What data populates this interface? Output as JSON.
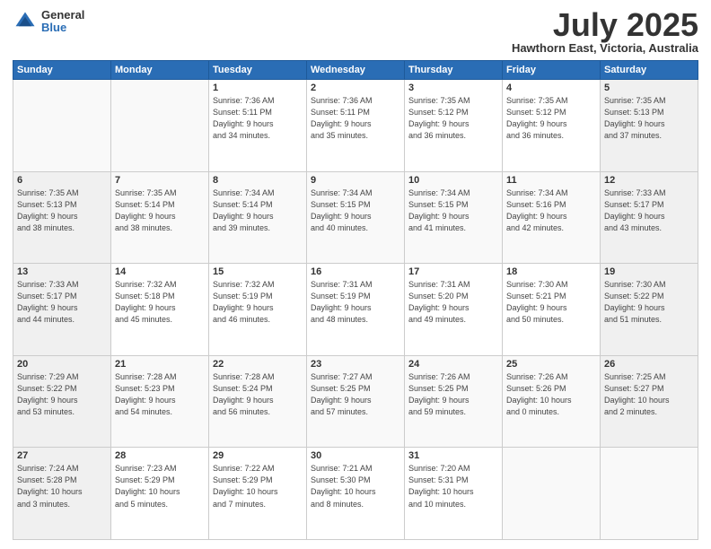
{
  "header": {
    "logo_general": "General",
    "logo_blue": "Blue",
    "month": "July 2025",
    "location": "Hawthorn East, Victoria, Australia"
  },
  "days_of_week": [
    "Sunday",
    "Monday",
    "Tuesday",
    "Wednesday",
    "Thursday",
    "Friday",
    "Saturday"
  ],
  "weeks": [
    [
      {
        "day": "",
        "info": ""
      },
      {
        "day": "",
        "info": ""
      },
      {
        "day": "1",
        "info": "Sunrise: 7:36 AM\nSunset: 5:11 PM\nDaylight: 9 hours\nand 34 minutes."
      },
      {
        "day": "2",
        "info": "Sunrise: 7:36 AM\nSunset: 5:11 PM\nDaylight: 9 hours\nand 35 minutes."
      },
      {
        "day": "3",
        "info": "Sunrise: 7:35 AM\nSunset: 5:12 PM\nDaylight: 9 hours\nand 36 minutes."
      },
      {
        "day": "4",
        "info": "Sunrise: 7:35 AM\nSunset: 5:12 PM\nDaylight: 9 hours\nand 36 minutes."
      },
      {
        "day": "5",
        "info": "Sunrise: 7:35 AM\nSunset: 5:13 PM\nDaylight: 9 hours\nand 37 minutes."
      }
    ],
    [
      {
        "day": "6",
        "info": "Sunrise: 7:35 AM\nSunset: 5:13 PM\nDaylight: 9 hours\nand 38 minutes."
      },
      {
        "day": "7",
        "info": "Sunrise: 7:35 AM\nSunset: 5:14 PM\nDaylight: 9 hours\nand 38 minutes."
      },
      {
        "day": "8",
        "info": "Sunrise: 7:34 AM\nSunset: 5:14 PM\nDaylight: 9 hours\nand 39 minutes."
      },
      {
        "day": "9",
        "info": "Sunrise: 7:34 AM\nSunset: 5:15 PM\nDaylight: 9 hours\nand 40 minutes."
      },
      {
        "day": "10",
        "info": "Sunrise: 7:34 AM\nSunset: 5:15 PM\nDaylight: 9 hours\nand 41 minutes."
      },
      {
        "day": "11",
        "info": "Sunrise: 7:34 AM\nSunset: 5:16 PM\nDaylight: 9 hours\nand 42 minutes."
      },
      {
        "day": "12",
        "info": "Sunrise: 7:33 AM\nSunset: 5:17 PM\nDaylight: 9 hours\nand 43 minutes."
      }
    ],
    [
      {
        "day": "13",
        "info": "Sunrise: 7:33 AM\nSunset: 5:17 PM\nDaylight: 9 hours\nand 44 minutes."
      },
      {
        "day": "14",
        "info": "Sunrise: 7:32 AM\nSunset: 5:18 PM\nDaylight: 9 hours\nand 45 minutes."
      },
      {
        "day": "15",
        "info": "Sunrise: 7:32 AM\nSunset: 5:19 PM\nDaylight: 9 hours\nand 46 minutes."
      },
      {
        "day": "16",
        "info": "Sunrise: 7:31 AM\nSunset: 5:19 PM\nDaylight: 9 hours\nand 48 minutes."
      },
      {
        "day": "17",
        "info": "Sunrise: 7:31 AM\nSunset: 5:20 PM\nDaylight: 9 hours\nand 49 minutes."
      },
      {
        "day": "18",
        "info": "Sunrise: 7:30 AM\nSunset: 5:21 PM\nDaylight: 9 hours\nand 50 minutes."
      },
      {
        "day": "19",
        "info": "Sunrise: 7:30 AM\nSunset: 5:22 PM\nDaylight: 9 hours\nand 51 minutes."
      }
    ],
    [
      {
        "day": "20",
        "info": "Sunrise: 7:29 AM\nSunset: 5:22 PM\nDaylight: 9 hours\nand 53 minutes."
      },
      {
        "day": "21",
        "info": "Sunrise: 7:28 AM\nSunset: 5:23 PM\nDaylight: 9 hours\nand 54 minutes."
      },
      {
        "day": "22",
        "info": "Sunrise: 7:28 AM\nSunset: 5:24 PM\nDaylight: 9 hours\nand 56 minutes."
      },
      {
        "day": "23",
        "info": "Sunrise: 7:27 AM\nSunset: 5:25 PM\nDaylight: 9 hours\nand 57 minutes."
      },
      {
        "day": "24",
        "info": "Sunrise: 7:26 AM\nSunset: 5:25 PM\nDaylight: 9 hours\nand 59 minutes."
      },
      {
        "day": "25",
        "info": "Sunrise: 7:26 AM\nSunset: 5:26 PM\nDaylight: 10 hours\nand 0 minutes."
      },
      {
        "day": "26",
        "info": "Sunrise: 7:25 AM\nSunset: 5:27 PM\nDaylight: 10 hours\nand 2 minutes."
      }
    ],
    [
      {
        "day": "27",
        "info": "Sunrise: 7:24 AM\nSunset: 5:28 PM\nDaylight: 10 hours\nand 3 minutes."
      },
      {
        "day": "28",
        "info": "Sunrise: 7:23 AM\nSunset: 5:29 PM\nDaylight: 10 hours\nand 5 minutes."
      },
      {
        "day": "29",
        "info": "Sunrise: 7:22 AM\nSunset: 5:29 PM\nDaylight: 10 hours\nand 7 minutes."
      },
      {
        "day": "30",
        "info": "Sunrise: 7:21 AM\nSunset: 5:30 PM\nDaylight: 10 hours\nand 8 minutes."
      },
      {
        "day": "31",
        "info": "Sunrise: 7:20 AM\nSunset: 5:31 PM\nDaylight: 10 hours\nand 10 minutes."
      },
      {
        "day": "",
        "info": ""
      },
      {
        "day": "",
        "info": ""
      }
    ]
  ]
}
